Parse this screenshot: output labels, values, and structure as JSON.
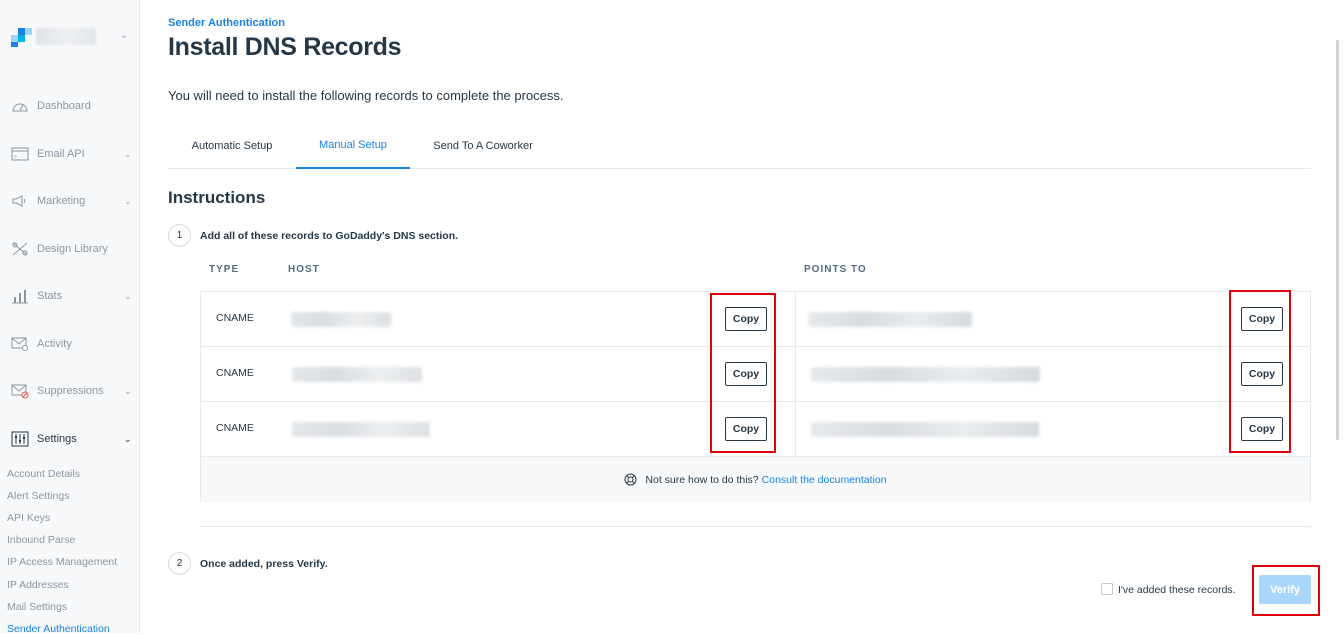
{
  "sidebar": {
    "nav": [
      {
        "label": "Dashboard",
        "icon": "gauge-icon",
        "chevron": false
      },
      {
        "label": "Email API",
        "icon": "code-window-icon",
        "chevron": true
      },
      {
        "label": "Marketing",
        "icon": "megaphone-icon",
        "chevron": true
      },
      {
        "label": "Design Library",
        "icon": "design-tools-icon",
        "chevron": false
      },
      {
        "label": "Stats",
        "icon": "bar-chart-icon",
        "chevron": true
      },
      {
        "label": "Activity",
        "icon": "mail-search-icon",
        "chevron": false
      },
      {
        "label": "Suppressions",
        "icon": "mail-block-icon",
        "chevron": true
      },
      {
        "label": "Settings",
        "icon": "sliders-icon",
        "chevron": true
      }
    ],
    "chevron_glyph": "⌄",
    "settings_sub": [
      "Account Details",
      "Alert Settings",
      "API Keys",
      "Inbound Parse",
      "IP Access Management",
      "IP Addresses",
      "Mail Settings",
      "Sender Authentication"
    ]
  },
  "header": {
    "eyebrow": "Sender Authentication",
    "title": "Install DNS Records",
    "intro": "You will need to install the following records to complete the process."
  },
  "tabs": [
    "Automatic Setup",
    "Manual Setup",
    "Send To A Coworker"
  ],
  "instructions_title": "Instructions",
  "steps": [
    {
      "num": "1",
      "text": "Add all of these records to GoDaddy's DNS section."
    },
    {
      "num": "2",
      "text": "Once added, press Verify."
    }
  ],
  "table": {
    "headers": {
      "type": "TYPE",
      "host": "HOST",
      "points_to": "POINTS TO"
    },
    "rows": [
      {
        "type": "CNAME"
      },
      {
        "type": "CNAME"
      },
      {
        "type": "CNAME"
      }
    ],
    "copy_label": "Copy",
    "help_text": "Not sure how to do this?",
    "help_link": "Consult the documentation"
  },
  "confirm": {
    "checkbox_label": "I've added these records.",
    "verify_label": "Verify"
  },
  "colors": {
    "accent": "#1a82e2",
    "annotation": "#e0000a",
    "verify_disabled": "#aad6fb"
  }
}
